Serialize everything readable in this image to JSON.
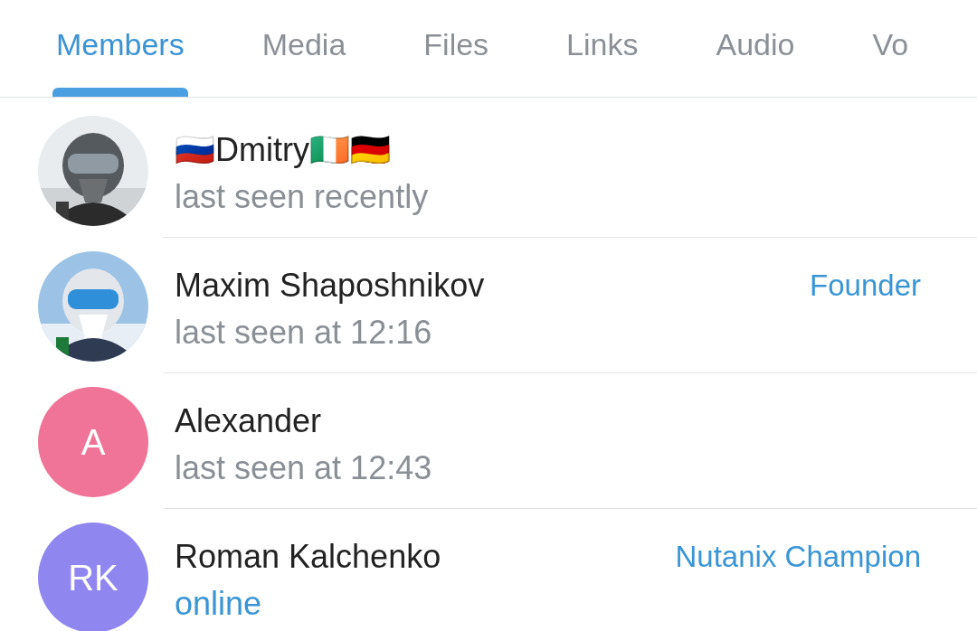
{
  "tabs": [
    {
      "label": "Members",
      "selected": true
    },
    {
      "label": "Media",
      "selected": false
    },
    {
      "label": "Files",
      "selected": false
    },
    {
      "label": "Links",
      "selected": false
    },
    {
      "label": "Audio",
      "selected": false
    },
    {
      "label": "Vo",
      "selected": false
    }
  ],
  "members": [
    {
      "name": "🇷🇺Dmitry🇮🇪🇩🇪",
      "status": "last seen recently",
      "online": false
    },
    {
      "name": "Maxim Shaposhnikov",
      "status": "last seen at 12:16",
      "online": false,
      "role": "Founder"
    },
    {
      "name": "Alexander",
      "status": "last seen at 12:43",
      "online": false,
      "avatar": {
        "kind": "initials",
        "initials": "A",
        "color": "#ef7497"
      }
    },
    {
      "name": "Roman Kalchenko",
      "status": "online",
      "online": true,
      "role": "Nutanix Champion",
      "avatar": {
        "kind": "initials",
        "initials": "RK",
        "color": "#8f86ef"
      }
    }
  ]
}
